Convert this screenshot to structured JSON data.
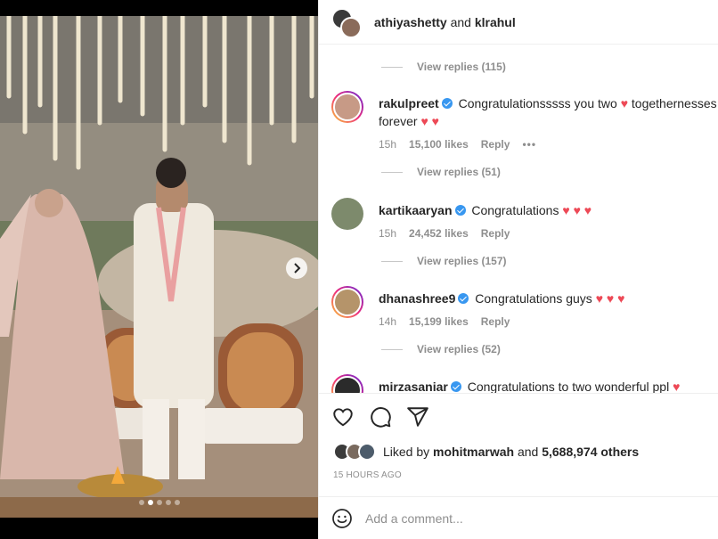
{
  "header": {
    "user1": "athiyashetty",
    "joiner": "and",
    "user2": "klrahul"
  },
  "comments": [
    {
      "replies_label": "View replies (115)"
    },
    {
      "username": "rakulpreet",
      "text": "Congratulationsssss you two",
      "text2": "togethernesses forever",
      "time": "15h",
      "likes": "15,100 likes",
      "reply": "Reply",
      "more": "•••",
      "replies_label": "View replies (51)",
      "avatar_color": "#c79a86"
    },
    {
      "username": "kartikaaryan",
      "text": "Congratulations",
      "time": "15h",
      "likes": "24,452 likes",
      "reply": "Reply",
      "replies_label": "View replies (157)",
      "avatar_color": "#7d8a6c"
    },
    {
      "username": "dhanashree9",
      "text": "Congratulations guys",
      "time": "14h",
      "likes": "15,199 likes",
      "reply": "Reply",
      "replies_label": "View replies (52)",
      "avatar_color": "#b5946a"
    },
    {
      "username": "mirzasaniar",
      "text": "Congratulations to two wonderful ppl",
      "avatar_color": "#2b2b2b"
    }
  ],
  "hearts": {
    "symbol": "♥"
  },
  "likes": {
    "prefix": "Liked by",
    "user": "mohitmarwah",
    "joiner": "and",
    "count": "5,688,974 others"
  },
  "timestamp": "15 hours ago",
  "add_comment": {
    "placeholder": "Add a comment..."
  },
  "icons": {
    "like": "heart-outline-icon",
    "comment": "comment-bubble-icon",
    "share": "paper-plane-icon",
    "emoji": "emoji-smiley-icon",
    "next": "chevron-right-icon"
  },
  "carousel": {
    "total": 5,
    "active_index": 1
  },
  "colors": {
    "verified": "#3897f0",
    "heart": "#ed4956",
    "muted": "#8e8e8e"
  }
}
